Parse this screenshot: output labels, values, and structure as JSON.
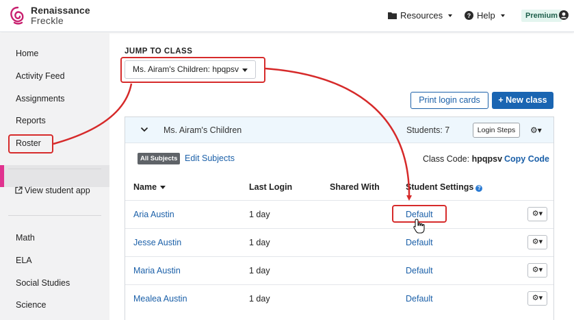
{
  "header": {
    "brand_line1": "Renaissance",
    "brand_line2": "Freckle",
    "resources_label": "Resources",
    "help_label": "Help",
    "premium_badge": "Premium"
  },
  "sidebar": {
    "items_top": [
      "Home",
      "Activity Feed",
      "Assignments",
      "Reports",
      "Roster"
    ],
    "active": "Roster",
    "view_student_app": "View student app",
    "subjects": [
      "Math",
      "ELA",
      "Social Studies",
      "Science"
    ]
  },
  "jump": {
    "label": "JUMP TO CLASS",
    "selected": "Ms. Airam's Children: hpqpsv"
  },
  "actions": {
    "print_label": "Print login cards",
    "new_class_label": "+ New class"
  },
  "class_panel": {
    "name": "Ms. Airam's Children",
    "students": "Students: 7",
    "login_steps": "Login Steps",
    "all_subjects": "All Subjects",
    "edit_subjects": "Edit Subjects",
    "class_code_label": "Class Code:",
    "class_code": "hpqpsv",
    "copy_code": "Copy Code"
  },
  "table": {
    "headers": [
      "Name",
      "Last Login",
      "Shared With",
      "Student Settings"
    ],
    "rows": [
      {
        "name": "Aria Austin",
        "last_login": "1 day",
        "shared_with": "",
        "settings": "Default"
      },
      {
        "name": "Jesse Austin",
        "last_login": "1 day",
        "shared_with": "",
        "settings": "Default"
      },
      {
        "name": "Maria Austin",
        "last_login": "1 day",
        "shared_with": "",
        "settings": "Default"
      },
      {
        "name": "Mealea Austin",
        "last_login": "1 day",
        "shared_with": "",
        "settings": "Default"
      }
    ]
  },
  "colors": {
    "accent_pink": "#e0328f",
    "link_blue": "#1a5fa8",
    "annotation_red": "#d62a2a"
  }
}
